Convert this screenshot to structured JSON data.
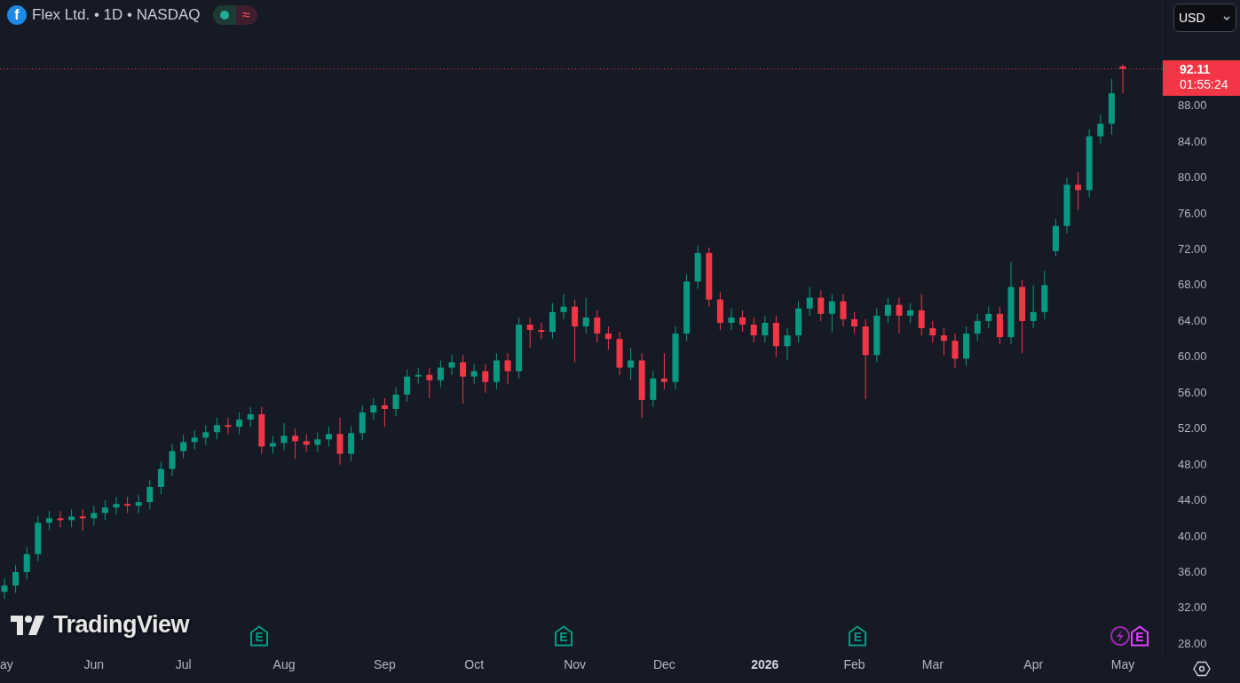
{
  "header": {
    "logo_letter": "f",
    "title": "Flex Ltd. • 1D • NASDAQ",
    "status": {
      "color": "#22ab94",
      "symbol": "≈"
    }
  },
  "currency_button": {
    "label": "USD"
  },
  "watermark_logo": {
    "text": "TradingView"
  },
  "chart_data": {
    "type": "candlestick",
    "ylim": [
      26.8,
      99.8
    ],
    "ref_lines": [
      {
        "axis": "y",
        "value": 92.11,
        "color": "#f23645"
      }
    ],
    "categories": [
      "ay",
      null,
      null,
      null,
      null,
      null,
      null,
      null,
      "Jun",
      null,
      null,
      null,
      null,
      null,
      null,
      null,
      "Jul",
      null,
      null,
      null,
      null,
      null,
      null,
      null,
      null,
      "Aug",
      null,
      null,
      null,
      null,
      null,
      null,
      null,
      null,
      "Sep",
      null,
      null,
      null,
      null,
      null,
      null,
      null,
      "Oct",
      null,
      null,
      null,
      null,
      null,
      null,
      null,
      null,
      "Nov",
      null,
      null,
      null,
      null,
      null,
      null,
      null,
      "Dec",
      null,
      null,
      null,
      null,
      null,
      null,
      null,
      null,
      "**2026**",
      null,
      null,
      null,
      null,
      null,
      null,
      null,
      "Feb",
      null,
      null,
      null,
      null,
      null,
      null,
      "Mar",
      null,
      null,
      null,
      null,
      null,
      null,
      null,
      null,
      "Apr",
      null,
      null,
      null,
      null,
      null,
      null,
      null,
      "May"
    ],
    "ohlc": [
      [
        33.8,
        35.3,
        33,
        34.5
      ],
      [
        34.5,
        36.8,
        33.7,
        36
      ],
      [
        36,
        38.8,
        35.2,
        38
      ],
      [
        38,
        42.3,
        37.2,
        41.5
      ],
      [
        41.5,
        42.8,
        40.7,
        42
      ],
      [
        42,
        42.8,
        41,
        41.8
      ],
      [
        41.8,
        43,
        41,
        42.2
      ],
      [
        42.2,
        43,
        40.6,
        42
      ],
      [
        42,
        43.4,
        41.2,
        42.6
      ],
      [
        42.6,
        44,
        41.8,
        43.2
      ],
      [
        43.2,
        44.4,
        42.4,
        43.6
      ],
      [
        43.6,
        44.4,
        42.6,
        43.4
      ],
      [
        43.4,
        44.6,
        42.6,
        43.8
      ],
      [
        43.8,
        46.3,
        43,
        45.5
      ],
      [
        45.5,
        48.3,
        44.7,
        47.5
      ],
      [
        47.5,
        50.3,
        46.7,
        49.5
      ],
      [
        49.5,
        51.3,
        48.7,
        50.5
      ],
      [
        50.5,
        51.8,
        49.7,
        51
      ],
      [
        51,
        52.4,
        50.2,
        51.6
      ],
      [
        51.6,
        53.2,
        50.8,
        52.4
      ],
      [
        52.4,
        53.2,
        51.4,
        52.2
      ],
      [
        52.2,
        53.8,
        51.4,
        53
      ],
      [
        53,
        54.4,
        52.2,
        53.6
      ],
      [
        53.6,
        54.4,
        49.2,
        50
      ],
      [
        50,
        51.2,
        49.2,
        50.4
      ],
      [
        50.4,
        52.6,
        49.6,
        51.2
      ],
      [
        51.2,
        52,
        48.6,
        50.6
      ],
      [
        50.6,
        51.4,
        49.4,
        50.2
      ],
      [
        50.2,
        51.6,
        49.4,
        50.8
      ],
      [
        50.8,
        52.2,
        50,
        51.4
      ],
      [
        51.4,
        53.2,
        48,
        49.2
      ],
      [
        49.2,
        52.3,
        48.4,
        51.5
      ],
      [
        51.5,
        54.6,
        50.7,
        53.8
      ],
      [
        53.8,
        55.4,
        53,
        54.6
      ],
      [
        54.6,
        55.4,
        52.2,
        54.2
      ],
      [
        54.2,
        56.6,
        53.4,
        55.8
      ],
      [
        55.8,
        58.6,
        55,
        57.8
      ],
      [
        57.8,
        58.8,
        57,
        58
      ],
      [
        58,
        58.8,
        55.4,
        57.4
      ],
      [
        57.4,
        59.6,
        56.6,
        58.8
      ],
      [
        58.8,
        60.2,
        58,
        59.4
      ],
      [
        59.4,
        60.2,
        54.8,
        57.8
      ],
      [
        57.8,
        59.2,
        57,
        58.4
      ],
      [
        58.4,
        59.2,
        56,
        57.2
      ],
      [
        57.2,
        60.4,
        56.4,
        59.6
      ],
      [
        59.6,
        60.4,
        57,
        58.4
      ],
      [
        58.4,
        64.4,
        57.6,
        63.6
      ],
      [
        63.6,
        64.4,
        61,
        63
      ],
      [
        63,
        63.8,
        62,
        62.8
      ],
      [
        62.8,
        66,
        62,
        65
      ],
      [
        65,
        67,
        64.2,
        65.6
      ],
      [
        65.6,
        66.4,
        59.4,
        63.4
      ],
      [
        63.4,
        66.6,
        62.6,
        64.4
      ],
      [
        64.4,
        65.2,
        61.6,
        62.6
      ],
      [
        62.6,
        63.4,
        60.8,
        62
      ],
      [
        62,
        62.8,
        58,
        58.8
      ],
      [
        58.8,
        61,
        57.4,
        59.6
      ],
      [
        59.6,
        60.4,
        53.2,
        55.2
      ],
      [
        55.2,
        58.4,
        54.4,
        57.6
      ],
      [
        57.6,
        60.4,
        56.4,
        57.2
      ],
      [
        57.2,
        63.4,
        56.4,
        62.6
      ],
      [
        62.6,
        69.2,
        61.8,
        68.4
      ],
      [
        68.4,
        72.4,
        67.6,
        71.6
      ],
      [
        71.6,
        72.2,
        65.6,
        66.4
      ],
      [
        66.4,
        67.2,
        63,
        63.8
      ],
      [
        63.8,
        65.4,
        63,
        64.4
      ],
      [
        64.4,
        65.2,
        62.8,
        63.6
      ],
      [
        63.6,
        64.4,
        61.6,
        62.4
      ],
      [
        62.4,
        64.6,
        61.6,
        63.8
      ],
      [
        63.8,
        64.6,
        60,
        61.2
      ],
      [
        61.2,
        63.2,
        59.6,
        62.4
      ],
      [
        62.4,
        66.2,
        61.6,
        65.4
      ],
      [
        65.4,
        67.8,
        64.6,
        66.6
      ],
      [
        66.6,
        67.4,
        64,
        64.8
      ],
      [
        64.8,
        67,
        62.8,
        66.2
      ],
      [
        66.2,
        67,
        63.4,
        64.2
      ],
      [
        64.2,
        65,
        62.6,
        63.4
      ],
      [
        63.4,
        64.2,
        55.3,
        60.2
      ],
      [
        60.2,
        65.4,
        59.4,
        64.6
      ],
      [
        64.6,
        66.6,
        63.8,
        65.8
      ],
      [
        65.8,
        66.6,
        62.6,
        64.6
      ],
      [
        64.6,
        66,
        63.8,
        65.2
      ],
      [
        65.2,
        67,
        62.4,
        63.2
      ],
      [
        63.2,
        64,
        61.6,
        62.4
      ],
      [
        62.4,
        63.2,
        60.2,
        61.8
      ],
      [
        61.8,
        62.6,
        58.8,
        59.8
      ],
      [
        59.8,
        63.4,
        59,
        62.6
      ],
      [
        62.6,
        64.8,
        61.8,
        64
      ],
      [
        64,
        65.6,
        63.2,
        64.8
      ],
      [
        64.8,
        65.6,
        61.4,
        62.2
      ],
      [
        62.2,
        70.6,
        61.4,
        67.8
      ],
      [
        67.8,
        68.6,
        60.4,
        64
      ],
      [
        64,
        68,
        63.2,
        65
      ],
      [
        65,
        69.6,
        64.2,
        68
      ],
      [
        71.8,
        75.4,
        71.2,
        74.6
      ],
      [
        74.6,
        80,
        73.8,
        79.2
      ],
      [
        79.2,
        80.6,
        76.4,
        78.6
      ],
      [
        78.6,
        85.4,
        77.8,
        84.6
      ],
      [
        84.6,
        87,
        83.8,
        86
      ],
      [
        86,
        91,
        84.8,
        89.4
      ],
      [
        92.4,
        92.6,
        89.4,
        92.11
      ]
    ],
    "yticks": [
      {
        "value": 88,
        "label": "88.00"
      },
      {
        "value": 84,
        "label": "84.00"
      },
      {
        "value": 80,
        "label": "80.00"
      },
      {
        "value": 76,
        "label": "76.00"
      },
      {
        "value": 72,
        "label": "72.00"
      },
      {
        "value": 68,
        "label": "68.00"
      },
      {
        "value": 64,
        "label": "64.00"
      },
      {
        "value": 60,
        "label": "60.00"
      },
      {
        "value": 56,
        "label": "56.00"
      },
      {
        "value": 52,
        "label": "52.00"
      },
      {
        "value": 48,
        "label": "48.00"
      },
      {
        "value": 44,
        "label": "44.00"
      },
      {
        "value": 40,
        "label": "40.00"
      },
      {
        "value": 36,
        "label": "36.00"
      },
      {
        "value": 32,
        "label": "32.00"
      },
      {
        "value": 28,
        "label": "28.00"
      }
    ]
  },
  "last_price": {
    "label": "92.11",
    "countdown": "01:55:24",
    "color": "#f23645"
  },
  "events": [
    {
      "kind": "earnings",
      "label": "E",
      "color": "#089981"
    },
    {
      "kind": "earnings",
      "label": "E",
      "color": "#089981"
    },
    {
      "kind": "earnings",
      "label": "E",
      "color": "#089981"
    },
    {
      "kind": "lightning",
      "color": "#9c27b0"
    },
    {
      "kind": "earnings",
      "label": "E",
      "color": "#e040fb"
    }
  ]
}
